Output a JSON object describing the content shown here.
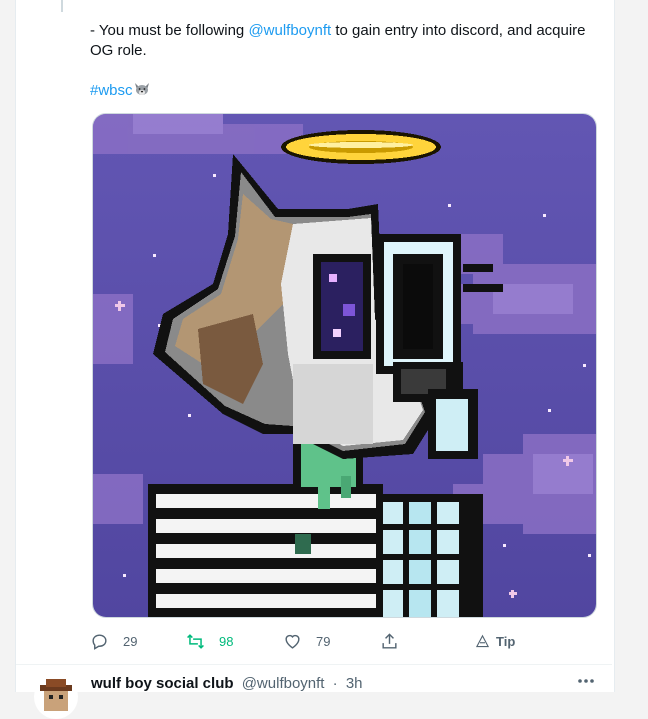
{
  "tweet": {
    "text_prefix": "- You must be following ",
    "mention": "@wulfboynft",
    "text_suffix": " to gain entry into discord, and acquire OG role.",
    "hashtag": "#wbsc",
    "image_alt": "Pixel art wolf with halo and skeleton"
  },
  "actions": {
    "replies": "29",
    "retweets": "98",
    "likes": "79",
    "tip_label": "Tip"
  },
  "next_tweet": {
    "author_name": "wulf boy social club",
    "handle": "@wulfboynft",
    "separator": "·",
    "time": "3h"
  },
  "colors": {
    "link": "#1d9bf0",
    "retweet_green": "#00ba7c",
    "muted": "#536471",
    "art_background": "#5b4ea8"
  },
  "icons": [
    "reply-icon",
    "retweet-icon",
    "like-icon",
    "share-icon",
    "tip-icon",
    "more-icon",
    "wolf-emoji-icon"
  ]
}
